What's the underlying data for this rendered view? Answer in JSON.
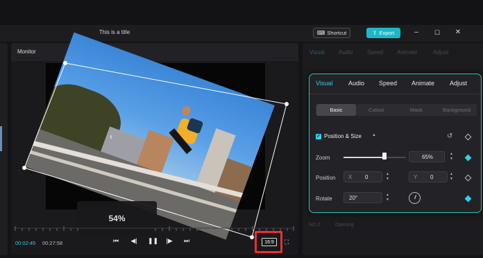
{
  "window": {
    "title": "This is a title",
    "shortcut_label": "Shortcut",
    "export_label": "Export"
  },
  "monitor": {
    "header": "Monitor",
    "zoom_overlay": "54%",
    "current_time": "00:02:45",
    "total_time": "00:27:58",
    "aspect_ratio": "16:9"
  },
  "background_panel": {
    "tabs": [
      "Visual",
      "Audio",
      "Speed",
      "Animate",
      "Adjust"
    ],
    "row_a": "NO 2",
    "row_b": "Opening"
  },
  "popup": {
    "tabs": [
      "Visual",
      "Audio",
      "Speed",
      "Animate",
      "Adjust"
    ],
    "active_tab": "Visual",
    "sub_tabs": [
      "Basic",
      "Cutout",
      "Mask",
      "Background"
    ],
    "active_sub_tab": "Basic",
    "section_title": "Position & Size",
    "zoom_label": "Zoom",
    "zoom_value": "65%",
    "zoom_fraction": 0.65,
    "position_label": "Position",
    "pos_x_prefix": "X",
    "pos_x": "0",
    "pos_y_prefix": "Y",
    "pos_y": "0",
    "rotate_label": "Rotate",
    "rotate_value": "20°"
  },
  "colors": {
    "accent": "#2fd0e8",
    "export_button": "#1cb7c8",
    "highlight_box": "#ea2f32"
  },
  "icons": [
    "keyboard-icon",
    "export-icon",
    "minimize-icon",
    "maximize-icon",
    "close-icon",
    "skip-back-icon",
    "step-back-icon",
    "pause-icon",
    "step-forward-icon",
    "skip-forward-icon",
    "fullscreen-icon",
    "reset-icon",
    "keyframe-icon",
    "rotate-dial-icon"
  ]
}
